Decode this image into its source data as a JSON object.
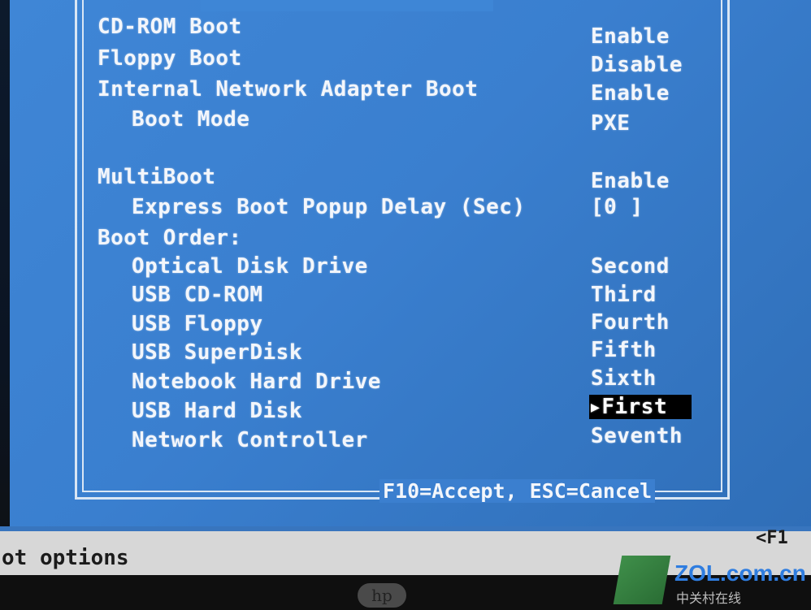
{
  "bios": {
    "items": [
      {
        "label": "CD-ROM Boot",
        "value": "Enable"
      },
      {
        "label": "Floppy Boot",
        "value": "Disable"
      },
      {
        "label": "Internal Network Adapter Boot",
        "value": "Enable"
      },
      {
        "label": "Boot Mode",
        "value": "PXE"
      },
      {
        "label": "MultiBoot",
        "value": "Enable"
      },
      {
        "label": "Express Boot Popup Delay (Sec)",
        "value": "[0 ]"
      },
      {
        "label": "Boot Order:",
        "value": ""
      },
      {
        "label": "Optical Disk Drive",
        "value": "Second"
      },
      {
        "label": "USB CD-ROM",
        "value": "Third"
      },
      {
        "label": "USB Floppy",
        "value": "Fourth"
      },
      {
        "label": "USB SuperDisk",
        "value": "Fifth"
      },
      {
        "label": "Notebook Hard Drive",
        "value": "Sixth"
      },
      {
        "label": "USB Hard Disk",
        "value": "First"
      },
      {
        "label": "Network Controller",
        "value": "Seventh"
      }
    ],
    "footer_keys": "F10=Accept, ESC=Cancel",
    "status_left": "ot options",
    "fkey_right": "<F1",
    "logo_bottom": "hp",
    "watermark_brand": "ZOL.com.cn",
    "watermark_sub": "中关村在线",
    "colors": {
      "screen_bg": "#3a7fcf",
      "text": "#f3f6fb",
      "highlight_bg": "#000000",
      "status_bar": "#d7d7d7"
    }
  }
}
